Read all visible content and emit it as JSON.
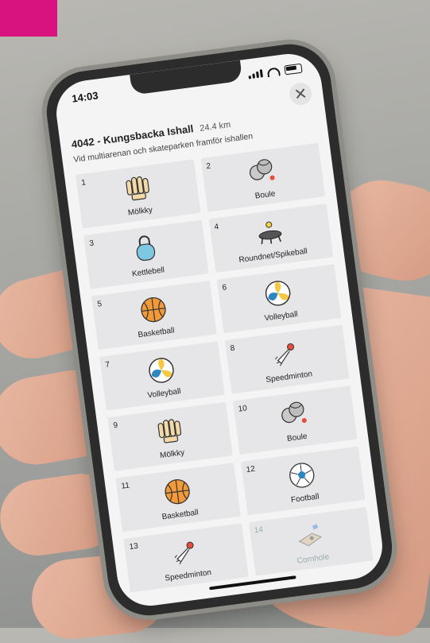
{
  "status": {
    "time": "14:03"
  },
  "header": {
    "title": "4042 - Kungsbacka Ishall",
    "distance": "24.4 km",
    "subtitle": "Vid multiarenan och skateparken framför ishallen"
  },
  "cards": [
    {
      "num": "1",
      "label": "Mölkky",
      "icon": "molkky-icon"
    },
    {
      "num": "2",
      "label": "Boule",
      "icon": "boule-icon"
    },
    {
      "num": "3",
      "label": "Kettlebell",
      "icon": "kettlebell-icon"
    },
    {
      "num": "4",
      "label": "Roundnet/Spikeball",
      "icon": "roundnet-icon"
    },
    {
      "num": "5",
      "label": "Basketball",
      "icon": "basketball-icon"
    },
    {
      "num": "6",
      "label": "Volleyball",
      "icon": "volleyball-icon"
    },
    {
      "num": "7",
      "label": "Volleyball",
      "icon": "volleyball-icon"
    },
    {
      "num": "8",
      "label": "Speedminton",
      "icon": "shuttlecock-icon"
    },
    {
      "num": "9",
      "label": "Mölkky",
      "icon": "molkky-icon"
    },
    {
      "num": "10",
      "label": "Boule",
      "icon": "boule-icon"
    },
    {
      "num": "11",
      "label": "Basketball",
      "icon": "basketball-icon"
    },
    {
      "num": "12",
      "label": "Football",
      "icon": "football-icon"
    },
    {
      "num": "13",
      "label": "Speedminton",
      "icon": "shuttlecock-icon"
    },
    {
      "num": "14",
      "label": "Cornhole",
      "icon": "cornhole-icon",
      "disabled": true
    }
  ],
  "colors": {
    "card": "#e6e6e8",
    "screen": "#f4f4f4",
    "basketball": "#f29a3a",
    "volley_yellow": "#f5c842",
    "volley_blue": "#2e86c1",
    "kettlebell": "#7ec8e3"
  }
}
